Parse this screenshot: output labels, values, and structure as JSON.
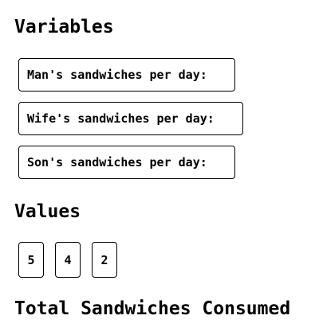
{
  "variables": {
    "heading": "Variables",
    "items": [
      {
        "label": "Man's sandwiches per day:"
      },
      {
        "label": "Wife's sandwiches per day:"
      },
      {
        "label": "Son's sandwiches per day:"
      }
    ]
  },
  "values": {
    "heading": "Values",
    "items": [
      {
        "value": "5"
      },
      {
        "value": "4"
      },
      {
        "value": "2"
      }
    ]
  },
  "total": {
    "heading": "Total Sandwiches Consumed"
  }
}
